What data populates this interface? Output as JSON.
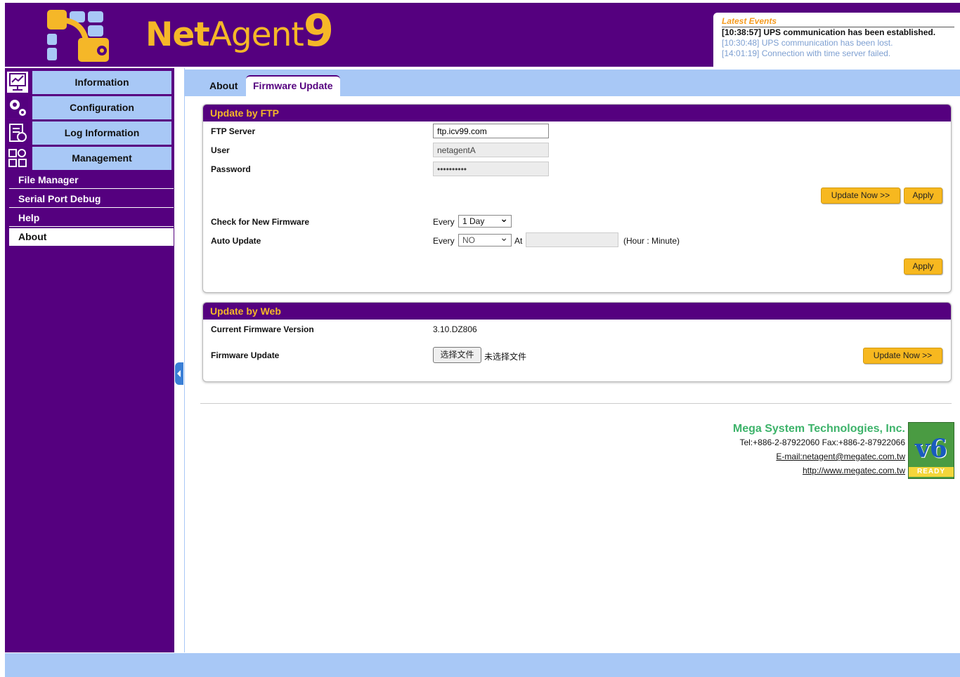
{
  "header": {
    "logo_text": {
      "net": "Net",
      "agent": "Agent",
      "nine": "9"
    },
    "events": {
      "title": "Latest Events",
      "items": [
        "[10:38:57] UPS communication has been established.",
        "[10:30:48] UPS communication has been lost.",
        "[14:01:19] Connection with time server failed."
      ]
    }
  },
  "sidebar": {
    "menus": [
      {
        "label": "Information",
        "icon": "monitor-chart-icon"
      },
      {
        "label": "Configuration",
        "icon": "gears-icon"
      },
      {
        "label": "Log Information",
        "icon": "calendar-log-icon"
      },
      {
        "label": "Management",
        "icon": "grid-settings-icon"
      }
    ],
    "submenus": [
      "File Manager",
      "Serial Port Debug",
      "Help",
      "About"
    ],
    "active_submenu": "About"
  },
  "tabs": [
    "About",
    "Firmware Update"
  ],
  "active_tab": "Firmware Update",
  "ftp": {
    "title": "Update by FTP",
    "server_label": "FTP Server",
    "server_value": "ftp.icv99.com",
    "user_label": "User",
    "user_value": "netagentA",
    "password_label": "Password",
    "password_value": "••••••••••",
    "update_now": "Update Now >>",
    "apply": "Apply",
    "check_label": "Check for New Firmware",
    "check_every": "Every",
    "check_value": "1 Day",
    "auto_label": "Auto Update",
    "auto_every": "Every",
    "auto_value": "NO",
    "auto_at": "At",
    "auto_time": "",
    "hour_minute": "(Hour : Minute)",
    "apply2": "Apply"
  },
  "web": {
    "title": "Update by Web",
    "version_label": "Current Firmware Version",
    "version_value": "3.10.DZ806",
    "fw_label": "Firmware Update",
    "choose_file": "选择文件",
    "no_file": "未选择文件",
    "update_now": "Update Now >>"
  },
  "company": {
    "name": "Mega System Technologies, Inc.",
    "tel": "Tel:+886-2-87922060 Fax:+886-2-87922066",
    "email": "E-mail:netagent@megatec.com.tw",
    "web": "http://www.megatec.com.tw",
    "badge_text": "v6",
    "badge_ready": "READY"
  },
  "colors": {
    "brand_purple": "#55007f",
    "accent_yellow": "#f5b728",
    "light_blue": "#a8c8f6",
    "button_yellow": "#f7b81f"
  }
}
